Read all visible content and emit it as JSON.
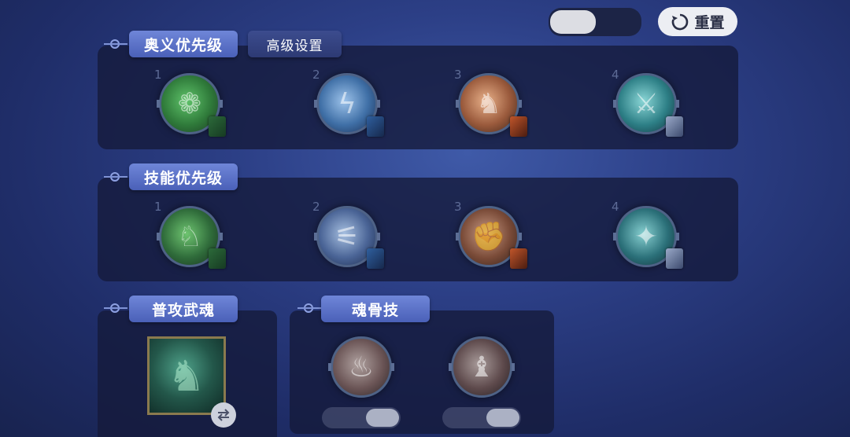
{
  "header": {
    "reset_label": "重置",
    "reset_icon": "refresh-icon",
    "top_toggle_on": false
  },
  "sections": {
    "ultimate": {
      "title": "奥义优先级",
      "advanced_label": "高级设置",
      "numbers": [
        "1",
        "2",
        "3",
        "4"
      ]
    },
    "skill": {
      "title": "技能优先级",
      "numbers": [
        "1",
        "2",
        "3",
        "4"
      ]
    },
    "normal_attack": {
      "title": "普攻武魂",
      "swap_icon": "swap-icon"
    },
    "soul_bone": {
      "title": "魂骨技",
      "toggles": [
        false,
        false
      ]
    }
  },
  "colors": {
    "accent": "#5a72c8",
    "panel": "#141a3a",
    "knob": "#dcdde3"
  }
}
